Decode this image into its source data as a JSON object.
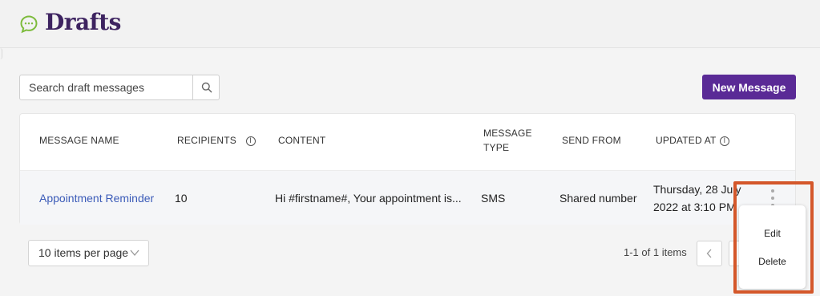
{
  "header": {
    "title": "Drafts",
    "logo_icon": "chat-bubble-icon"
  },
  "toolbar": {
    "search_placeholder": "Search draft messages",
    "search_icon": "search-icon",
    "new_message_label": "New Message"
  },
  "table": {
    "columns": {
      "name": "MESSAGE NAME",
      "recipients": "RECIPIENTS",
      "content": "CONTENT",
      "type_line1": "MESSAGE",
      "type_line2": "TYPE",
      "send_from": "SEND FROM",
      "updated_at": "UPDATED AT"
    },
    "rows": [
      {
        "name": "Appointment Reminder",
        "recipients": "10",
        "content": "Hi #firstname#, Your appointment is...",
        "type": "SMS",
        "send_from": "Shared number",
        "updated_line1": "Thursday, 28 July",
        "updated_line2": "2022 at 3:10 PM"
      }
    ]
  },
  "pagination": {
    "per_page": "10 items per page",
    "range": "1-1 of 1 items"
  },
  "row_menu": {
    "edit": "Edit",
    "delete": "Delete"
  },
  "colors": {
    "brand": "#5a2a96",
    "title": "#3d2360",
    "link": "#3b5bb8",
    "highlight": "#d4572a",
    "logo": "#7dbb3c"
  }
}
